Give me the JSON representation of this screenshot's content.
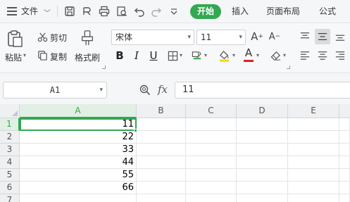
{
  "menubar": {
    "file_label": "文件",
    "tabs": [
      {
        "label": "开始",
        "active": true
      },
      {
        "label": "插入",
        "active": false
      },
      {
        "label": "页面布局",
        "active": false
      },
      {
        "label": "公式",
        "active": false
      }
    ],
    "quick_access_icons": [
      "save-icon",
      "undo-history-icon",
      "print-icon",
      "print-preview-icon",
      "undo-icon",
      "redo-icon",
      "customize-dropdown-icon"
    ],
    "accent_color": "#32a852"
  },
  "ribbon": {
    "paste_label": "粘贴",
    "cut_label": "剪切",
    "copy_label": "复制",
    "format_painter_label": "格式刷",
    "font_name": "宋体",
    "font_size": "11",
    "bold_glyph": "B",
    "italic_glyph": "I",
    "underline_glyph": "U",
    "grow_font_glyph": "A",
    "shrink_font_glyph": "A",
    "font_color_glyph": "A",
    "font_color": "#e02020",
    "highlight_color": "#f5d400"
  },
  "formula_bar": {
    "name_box": "A1",
    "fx_label": "fx",
    "formula_value": "11"
  },
  "sheet": {
    "columns": [
      "A",
      "B",
      "C",
      "D",
      "E"
    ],
    "selected_column": "A",
    "rows": [
      {
        "num": "1",
        "A": "11"
      },
      {
        "num": "2",
        "A": "22"
      },
      {
        "num": "3",
        "A": "33"
      },
      {
        "num": "4",
        "A": "44"
      },
      {
        "num": "5",
        "A": "55"
      },
      {
        "num": "6",
        "A": "66"
      },
      {
        "num": "7",
        "A": ""
      }
    ],
    "selected_row": "1"
  }
}
